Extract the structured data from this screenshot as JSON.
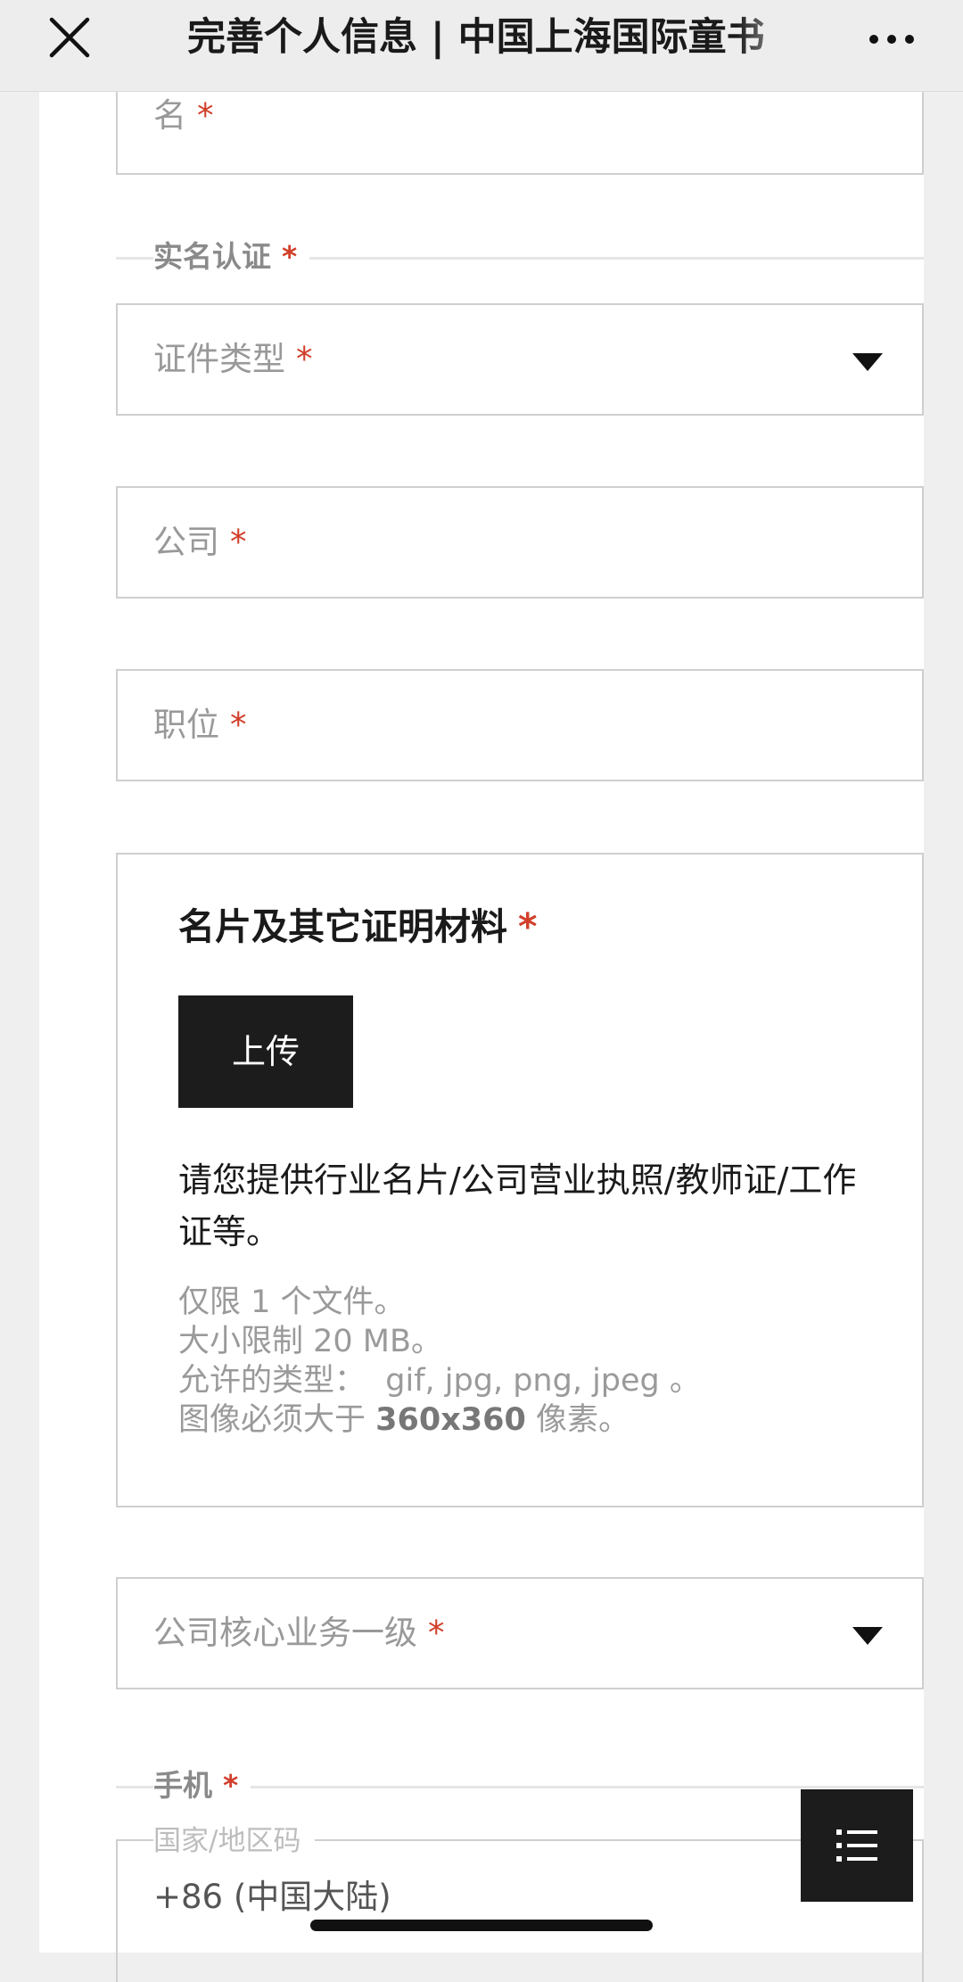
{
  "header": {
    "title": "完善个人信息 | 中国上海国际童书",
    "close_icon": "close-icon",
    "more_icon": "more-dots-icon"
  },
  "form": {
    "first_name": {
      "label": "名"
    },
    "identity_section": {
      "title": "实名认证"
    },
    "id_type": {
      "label": "证件类型"
    },
    "company": {
      "label": "公司"
    },
    "position": {
      "label": "职位"
    },
    "attachment": {
      "title": "名片及其它证明材料",
      "upload_label": "上传",
      "description": "请您提供行业名片/公司营业执照/教师证/工作证等。",
      "notes": {
        "limit_count": "仅限 1 个文件。",
        "size_limit": "大小限制 20 MB。",
        "types_prefix": "允许的类型：",
        "types": "gif, jpg, png, jpeg",
        "types_suffix": "。",
        "resolution_prefix": "图像必须大于",
        "resolution": "360x360",
        "resolution_suffix": "像素。"
      }
    },
    "business": {
      "label": "公司核心业务一级"
    },
    "phone_section": {
      "title": "手机"
    },
    "country_code": {
      "legend": "国家/地区码",
      "value": "+86 (中国大陆)"
    },
    "required_mark": "*"
  },
  "fab": {
    "icon": "list-menu-icon"
  },
  "colors": {
    "required": "#d13f2a",
    "button": "#1c1c1c",
    "border": "#cfcfcf"
  }
}
